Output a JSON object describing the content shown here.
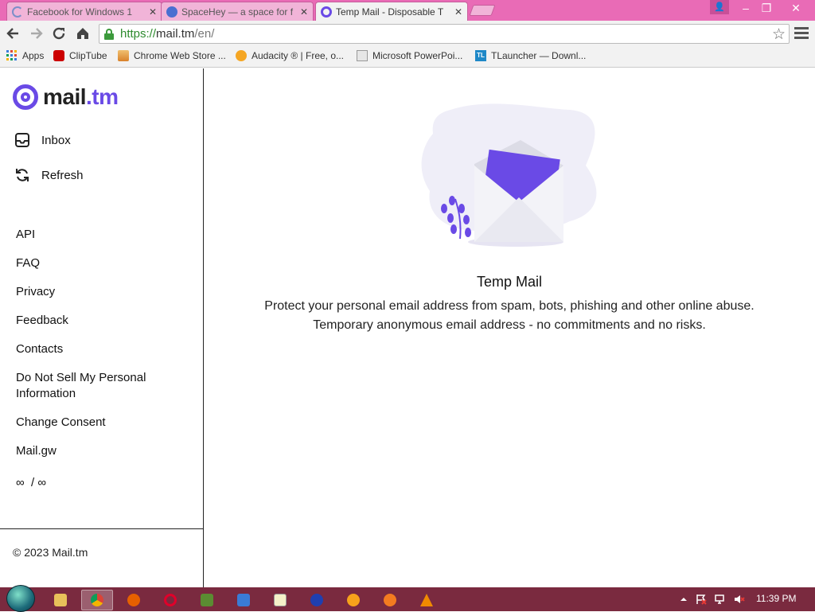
{
  "browser": {
    "tabs": [
      {
        "title": "Facebook for Windows 1",
        "close": "✕",
        "active": false,
        "favicon": "spinner-icon"
      },
      {
        "title": "SpaceHey — a space for f",
        "close": "✕",
        "active": false,
        "favicon": "spacehey-icon"
      },
      {
        "title": "Temp Mail - Disposable T",
        "close": "✕",
        "active": true,
        "favicon": "mail-at-icon"
      }
    ],
    "window_controls": {
      "minimize": "–",
      "restore": "❐",
      "close": "✕",
      "user": "👤"
    },
    "address": {
      "scheme": "https://",
      "host": "mail.tm",
      "path": "/en/"
    },
    "bookmarks": [
      {
        "label": "Apps",
        "icon": "apps-grid-icon",
        "color": "#3b7ddd"
      },
      {
        "label": "ClipTube",
        "icon": "youtube-icon",
        "color": "#cc0000"
      },
      {
        "label": "Chrome Web Store ...",
        "icon": "web-store-icon",
        "color": "#d9822b"
      },
      {
        "label": "Audacity ® | Free, o...",
        "icon": "headphones-icon",
        "color": "#f5a623"
      },
      {
        "label": "Microsoft PowerPoi...",
        "icon": "page-icon",
        "color": "#b0b0b0"
      },
      {
        "label": "TLauncher — Downl...",
        "icon": "tl-icon",
        "color": "#1e88c7"
      }
    ]
  },
  "app": {
    "logo": {
      "name": "mail",
      "tld": ".tm"
    },
    "nav": [
      {
        "label": "Inbox",
        "icon": "inbox-icon"
      },
      {
        "label": "Refresh",
        "icon": "refresh-icon"
      }
    ],
    "links": [
      "API",
      "FAQ",
      "Privacy",
      "Feedback",
      "Contacts",
      "Do Not Sell My Personal Information",
      "Change Consent",
      "Mail.gw",
      "∞  / ∞"
    ],
    "copyright": "© 2023 Mail.tm",
    "hero": {
      "title": "Temp Mail",
      "line1": "Protect your personal email address from spam, bots, phishing and other online abuse.",
      "line2": "Temporary anonymous email address - no commitments and no risks."
    },
    "accent": "#6a4ae6"
  },
  "taskbar": {
    "clock": "11:39 PM",
    "apps": [
      "file-explorer-icon",
      "chrome-icon",
      "firefox-icon",
      "opera-icon",
      "minecraft-icon",
      "monitor-icon",
      "notepad-icon",
      "audacity-icon",
      "fire-icon",
      "avast-icon",
      "vlc-icon"
    ],
    "tray": [
      "chevron-up-icon",
      "action-center-icon",
      "network-icon",
      "volume-muted-icon"
    ]
  }
}
